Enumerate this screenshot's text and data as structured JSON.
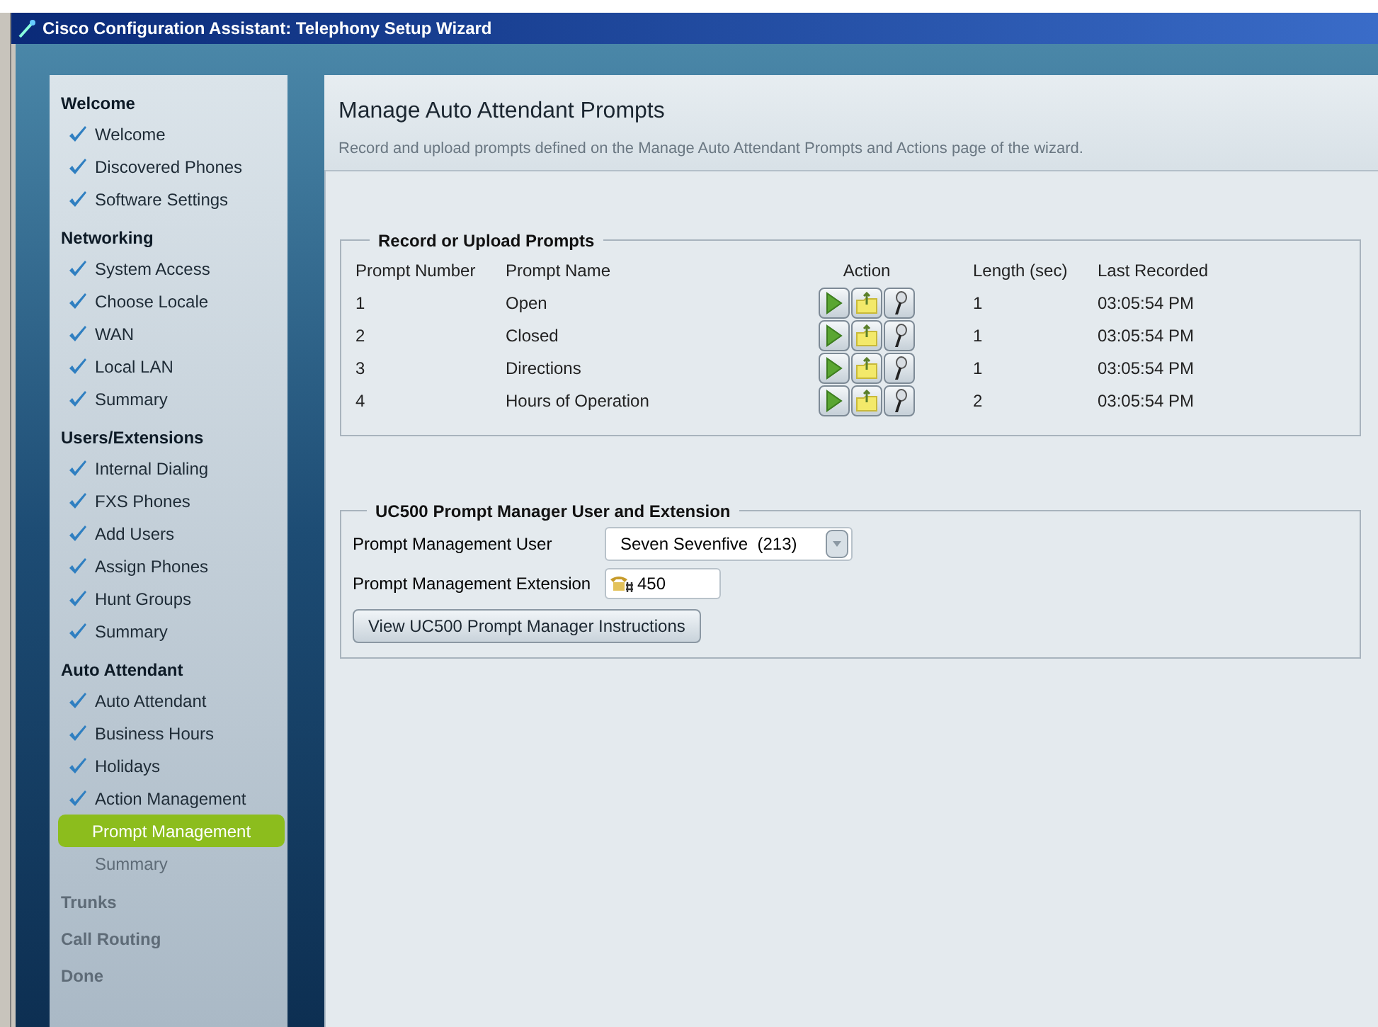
{
  "window": {
    "title": "Cisco Configuration Assistant: Telephony Setup Wizard"
  },
  "sidebar": {
    "sections": [
      {
        "title": "Welcome",
        "disabled": false,
        "items": [
          {
            "label": "Welcome",
            "checked": true,
            "selected": false
          },
          {
            "label": "Discovered Phones",
            "checked": true,
            "selected": false
          },
          {
            "label": "Software Settings",
            "checked": true,
            "selected": false
          }
        ]
      },
      {
        "title": "Networking",
        "disabled": false,
        "items": [
          {
            "label": "System Access",
            "checked": true,
            "selected": false
          },
          {
            "label": "Choose Locale",
            "checked": true,
            "selected": false
          },
          {
            "label": "WAN",
            "checked": true,
            "selected": false
          },
          {
            "label": "Local LAN",
            "checked": true,
            "selected": false
          },
          {
            "label": "Summary",
            "checked": true,
            "selected": false
          }
        ]
      },
      {
        "title": "Users/Extensions",
        "disabled": false,
        "items": [
          {
            "label": "Internal Dialing",
            "checked": true,
            "selected": false
          },
          {
            "label": "FXS Phones",
            "checked": true,
            "selected": false
          },
          {
            "label": "Add Users",
            "checked": true,
            "selected": false
          },
          {
            "label": "Assign Phones",
            "checked": true,
            "selected": false
          },
          {
            "label": "Hunt Groups",
            "checked": true,
            "selected": false
          },
          {
            "label": "Summary",
            "checked": true,
            "selected": false
          }
        ]
      },
      {
        "title": "Auto Attendant",
        "disabled": false,
        "items": [
          {
            "label": "Auto Attendant",
            "checked": true,
            "selected": false
          },
          {
            "label": "Business Hours",
            "checked": true,
            "selected": false
          },
          {
            "label": "Holidays",
            "checked": true,
            "selected": false
          },
          {
            "label": "Action Management",
            "checked": true,
            "selected": false
          },
          {
            "label": "Prompt Management",
            "checked": false,
            "selected": true
          },
          {
            "label": "Summary",
            "checked": false,
            "selected": false
          }
        ]
      },
      {
        "title": "Trunks",
        "disabled": true
      },
      {
        "title": "Call Routing",
        "disabled": true
      },
      {
        "title": "Done",
        "disabled": true
      }
    ]
  },
  "page": {
    "title": "Manage Auto Attendant Prompts",
    "subtitle": "Record and upload prompts defined on the Manage Auto Attendant Prompts and Actions page of the wizard."
  },
  "prompts_group": {
    "title": "Record or Upload Prompts",
    "columns": [
      "Prompt Number",
      "Prompt Name",
      "Action",
      "Length (sec)",
      "Last Recorded"
    ],
    "rows": [
      {
        "number": "1",
        "name": "Open",
        "length": "1",
        "last_recorded": "03:05:54 PM"
      },
      {
        "number": "2",
        "name": "Closed",
        "length": "1",
        "last_recorded": "03:05:54 PM"
      },
      {
        "number": "3",
        "name": "Directions",
        "length": "1",
        "last_recorded": "03:05:54 PM"
      },
      {
        "number": "4",
        "name": "Hours of Operation",
        "length": "2",
        "last_recorded": "03:05:54 PM"
      }
    ]
  },
  "manager_group": {
    "title": "UC500 Prompt Manager User and Extension",
    "user_label": "Prompt Management User",
    "user_value": "Seven Sevenfive  (213)",
    "extension_label": "Prompt Management Extension",
    "extension_value": "450",
    "button": "View UC500 Prompt Manager Instructions"
  }
}
